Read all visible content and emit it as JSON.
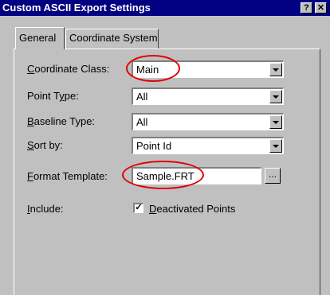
{
  "window": {
    "title": "Custom ASCII Export Settings",
    "help_label": "?",
    "close_label": "✕"
  },
  "tabs": [
    {
      "label": "General",
      "active": true
    },
    {
      "label": "Coordinate System",
      "active": false
    }
  ],
  "fields": {
    "coordinate_class": {
      "access_key": "C",
      "label_rest": "oordinate Class:",
      "value": "Main"
    },
    "point_type": {
      "label_pre": "Point T",
      "access_key": "y",
      "label_post": "pe:",
      "value": "All"
    },
    "baseline_type": {
      "access_key": "B",
      "label_rest": "aseline Type:",
      "value": "All"
    },
    "sort_by": {
      "access_key": "S",
      "label_rest": "ort by:",
      "value": "Point Id"
    },
    "format_template": {
      "access_key": "F",
      "label_rest": "ormat Template:",
      "value": "Sample.FRT",
      "browse_label": "..."
    },
    "include": {
      "access_key": "I",
      "label_rest": "nclude:"
    }
  },
  "options": {
    "deactivated_points": {
      "access_key": "D",
      "label_rest": "eactivated Points",
      "checked": true,
      "mark": "✓"
    }
  },
  "colors": {
    "title_bar": "#000080",
    "face": "#c0c0c0",
    "highlight": "#e00000"
  }
}
